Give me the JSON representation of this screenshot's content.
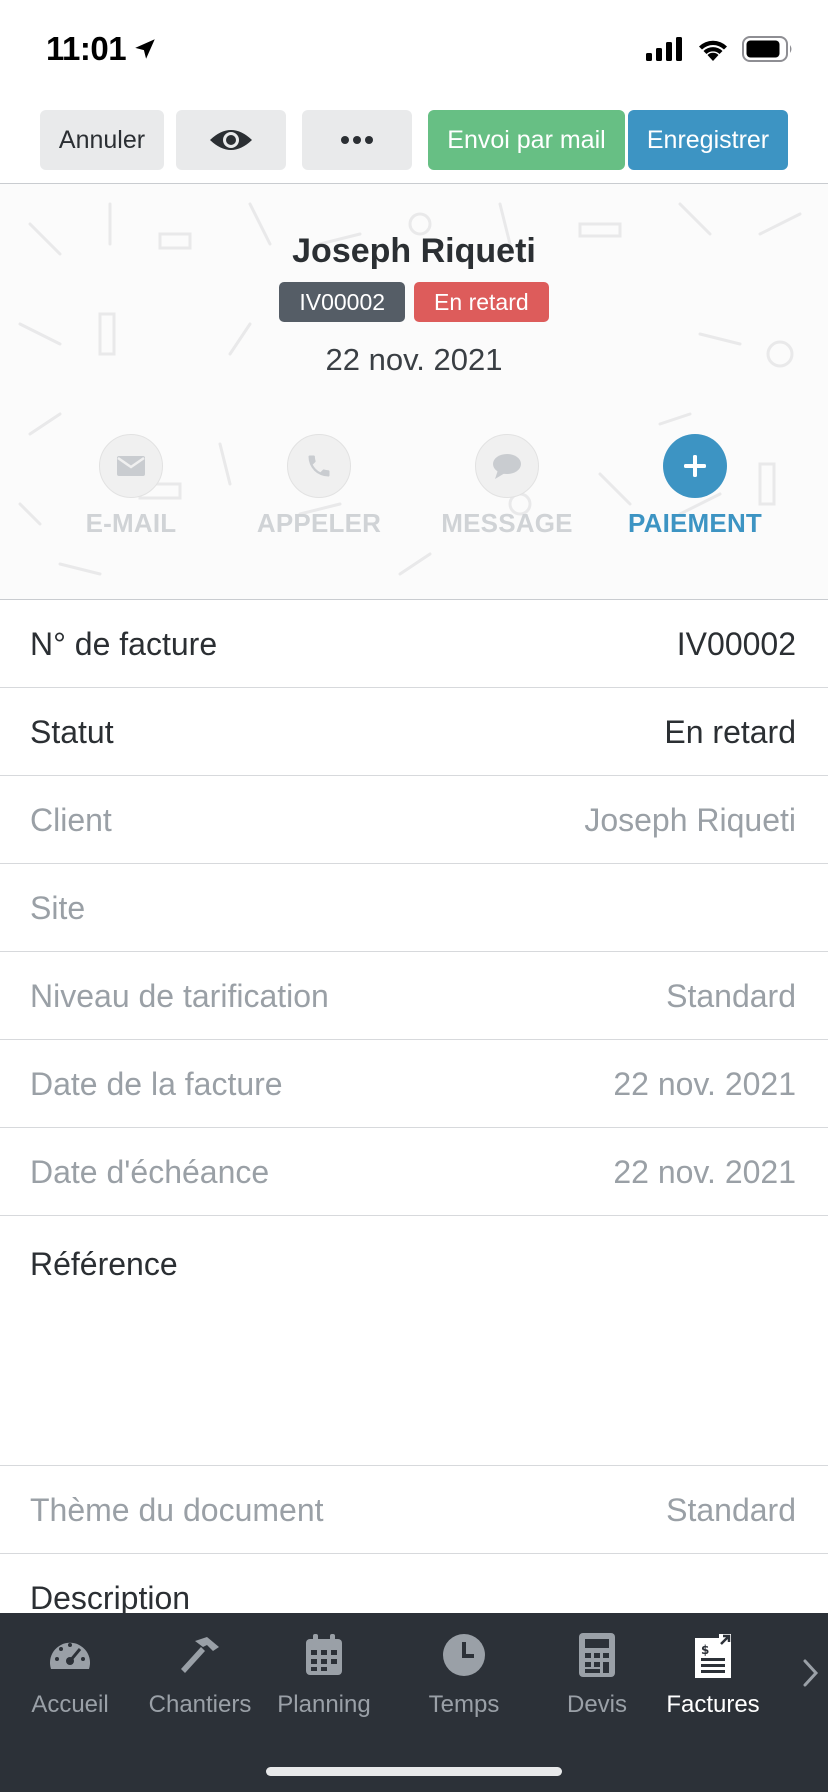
{
  "status_bar": {
    "time": "11:01"
  },
  "toolbar": {
    "cancel_label": "Annuler",
    "preview_icon": "eye-icon",
    "more_icon": "more-dots-icon",
    "email_label": "Envoi par mail",
    "save_label": "Enregistrer"
  },
  "header": {
    "client_name": "Joseph Riqueti",
    "invoice_badge": "IV00002",
    "status_badge": "En retard",
    "date": "22 nov. 2021",
    "actions": [
      {
        "label": "E-MAIL",
        "icon": "mail-icon",
        "active": false
      },
      {
        "label": "APPELER",
        "icon": "phone-icon",
        "active": false
      },
      {
        "label": "MESSAGE",
        "icon": "chat-bubble-icon",
        "active": false
      },
      {
        "label": "PAIEMENT",
        "icon": "plus-icon",
        "active": true
      }
    ]
  },
  "fields": [
    {
      "label": "N° de facture",
      "value": "IV00002"
    },
    {
      "label": "Statut",
      "value": "En retard"
    },
    {
      "label": "Client",
      "value": "Joseph Riqueti"
    },
    {
      "label": "Site",
      "value": ""
    },
    {
      "label": "Niveau de tarification",
      "value": "Standard"
    },
    {
      "label": "Date de la facture",
      "value": "22 nov. 2021"
    },
    {
      "label": "Date d'échéance",
      "value": "22 nov. 2021"
    },
    {
      "label": "Référence",
      "value": ""
    },
    {
      "label": "Thème du document",
      "value": "Standard"
    },
    {
      "label": "Description",
      "value": ""
    }
  ],
  "tabbar": {
    "tabs": [
      {
        "label": "Accueil",
        "icon": "speedometer-icon"
      },
      {
        "label": "Chantiers",
        "icon": "hammer-icon"
      },
      {
        "label": "Planning",
        "icon": "calendar-icon"
      },
      {
        "label": "Temps",
        "icon": "clock-icon"
      },
      {
        "label": "Devis",
        "icon": "calculator-icon"
      },
      {
        "label": "Factures",
        "icon": "invoice-icon"
      }
    ],
    "active_tab": "Factures"
  },
  "colors": {
    "accent_blue": "#3d94c3",
    "accent_green": "#67bf84",
    "overdue_red": "#dd5c5b",
    "badge_dark": "#555d66",
    "tabbar_bg": "#2c3138"
  }
}
